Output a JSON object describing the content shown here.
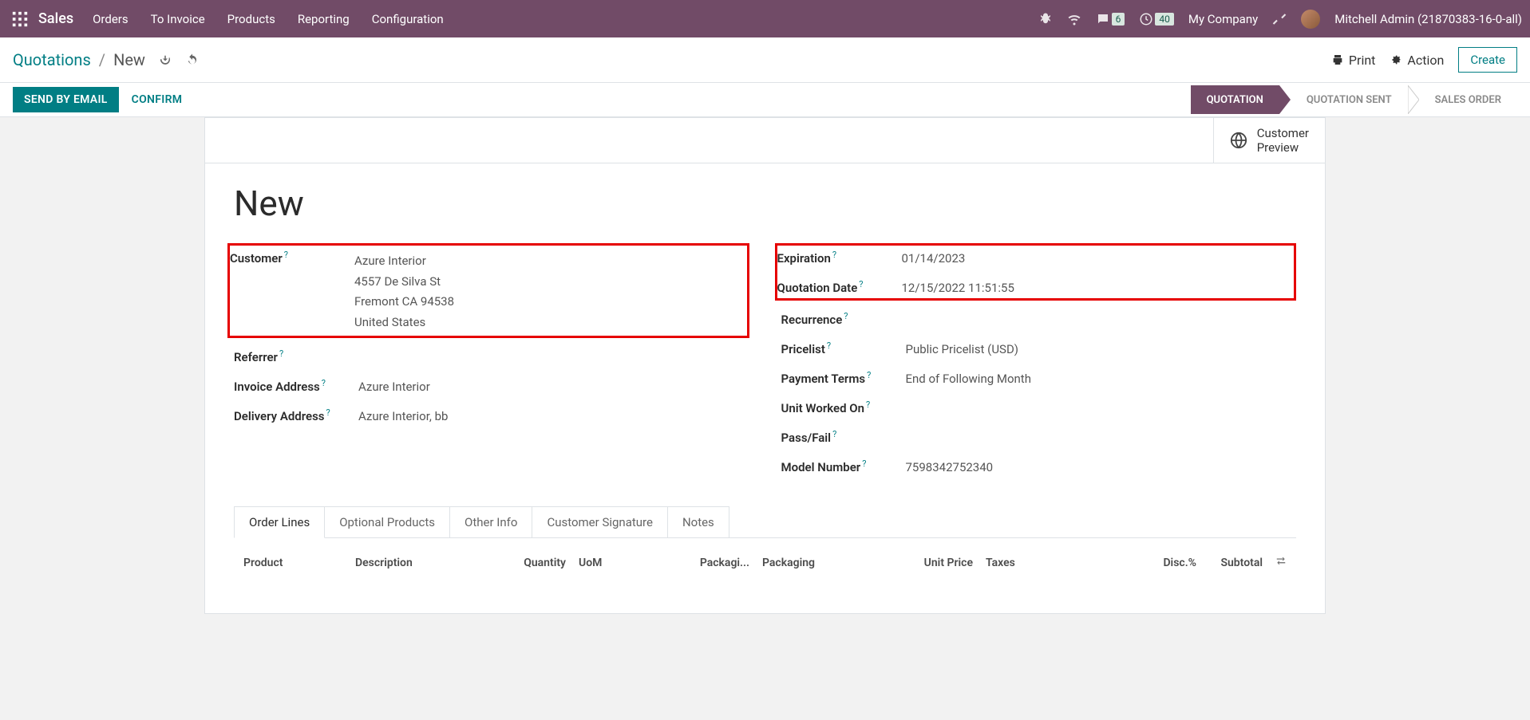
{
  "topnav": {
    "brand": "Sales",
    "menu": [
      "Orders",
      "To Invoice",
      "Products",
      "Reporting",
      "Configuration"
    ],
    "chat_badge": "6",
    "activity_badge": "40",
    "company": "My Company",
    "user": "Mitchell Admin (21870383-16-0-all)"
  },
  "breadcrumb": {
    "root": "Quotations",
    "current": "New"
  },
  "controlbar": {
    "print": "Print",
    "action": "Action",
    "create": "Create"
  },
  "buttons": {
    "send": "SEND BY EMAIL",
    "confirm": "CONFIRM"
  },
  "status": {
    "quotation": "QUOTATION",
    "sent": "QUOTATION SENT",
    "order": "SALES ORDER"
  },
  "preview": {
    "l1": "Customer",
    "l2": "Preview"
  },
  "form": {
    "title": "New",
    "left": {
      "customer_label": "Customer",
      "customer_name": "Azure Interior",
      "customer_street": "4557 De Silva St",
      "customer_city": "Fremont CA 94538",
      "customer_country": "United States",
      "referrer_label": "Referrer",
      "invoice_addr_label": "Invoice Address",
      "invoice_addr": "Azure Interior",
      "delivery_addr_label": "Delivery Address",
      "delivery_addr": "Azure Interior, bb"
    },
    "right": {
      "expiration_label": "Expiration",
      "expiration": "01/14/2023",
      "quote_date_label": "Quotation Date",
      "quote_date": "12/15/2022 11:51:55",
      "recurrence_label": "Recurrence",
      "pricelist_label": "Pricelist",
      "pricelist": "Public Pricelist (USD)",
      "payment_terms_label": "Payment Terms",
      "payment_terms": "End of Following Month",
      "unit_worked_label": "Unit Worked On",
      "passfail_label": "Pass/Fail",
      "model_num_label": "Model Number",
      "model_num": "7598342752340"
    }
  },
  "tabs": [
    "Order Lines",
    "Optional Products",
    "Other Info",
    "Customer Signature",
    "Notes"
  ],
  "table": {
    "product": "Product",
    "description": "Description",
    "quantity": "Quantity",
    "uom": "UoM",
    "packaging_qty": "Packagi...",
    "packaging": "Packaging",
    "unit_price": "Unit Price",
    "taxes": "Taxes",
    "disc": "Disc.%",
    "subtotal": "Subtotal"
  }
}
